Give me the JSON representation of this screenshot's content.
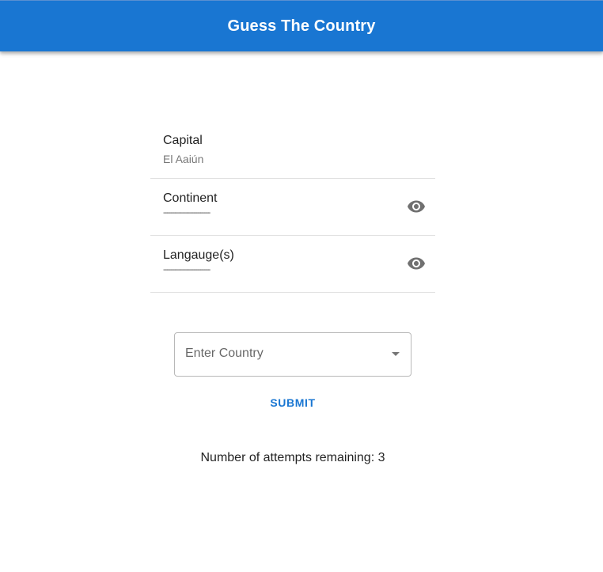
{
  "appbar": {
    "title": "Guess The Country",
    "color": "#1976d2"
  },
  "hints": [
    {
      "label": "Capital",
      "value": "El Aaiún",
      "revealed": true
    },
    {
      "label": "Continent",
      "value": "------------------------",
      "revealed": false,
      "icon": "eye-icon"
    },
    {
      "label": "Langauge(s)",
      "value": "------------------------",
      "revealed": false,
      "icon": "eye-icon"
    }
  ],
  "country_select": {
    "placeholder": "Enter Country",
    "icon": "dropdown-arrow-icon"
  },
  "submit": {
    "label": "SUBMIT"
  },
  "attempts": {
    "text": "Number of attempts remaining: 3"
  }
}
